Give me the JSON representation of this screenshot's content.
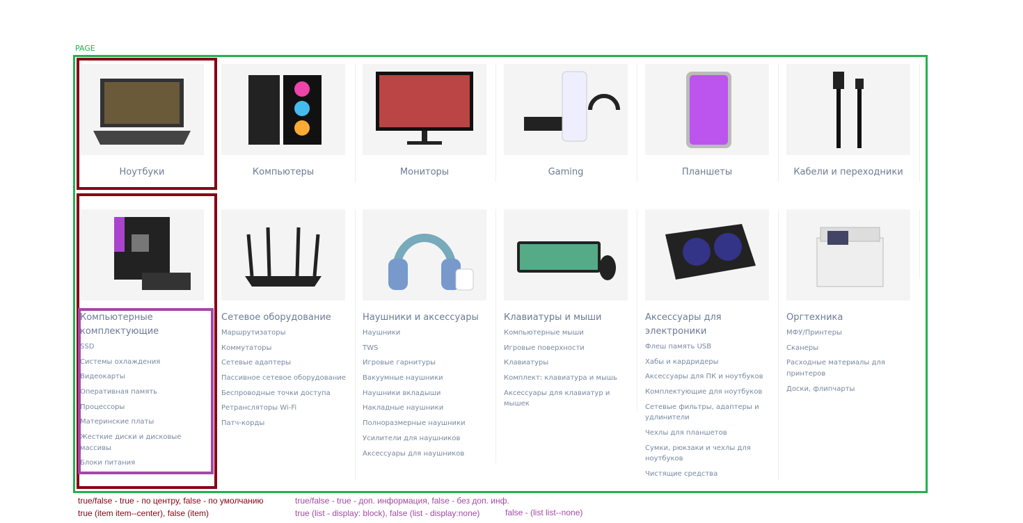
{
  "page_label": "PAGE",
  "row1": [
    {
      "label": "Ноутбуки",
      "icon": "laptop"
    },
    {
      "label": "Компьютеры",
      "icon": "pc-case"
    },
    {
      "label": "Мониторы",
      "icon": "monitor"
    },
    {
      "label": "Gaming",
      "icon": "console"
    },
    {
      "label": "Планшеты",
      "icon": "tablet"
    },
    {
      "label": "Кабели и переходники",
      "icon": "cable"
    }
  ],
  "row2": [
    {
      "title": "Компьютерные комплектующие",
      "icon": "motherboard",
      "items": [
        "SSD",
        "Системы охлаждения",
        "Видеокарты",
        "Оперативная память",
        "Процессоры",
        "Материнские платы",
        "Жесткие диски и дисковые массивы",
        "Блоки питания"
      ]
    },
    {
      "title": "Сетевое оборудование",
      "icon": "router",
      "items": [
        "Маршрутизаторы",
        "Коммутаторы",
        "Сетевые адаптеры",
        "Пассивное сетевое оборудование",
        "Беспроводные точки доступа",
        "Ретрансляторы Wi-Fi",
        "Патч-корды"
      ]
    },
    {
      "title": "Наушники и аксессуары",
      "icon": "headphones",
      "items": [
        "Наушники",
        "TWS",
        "Игровые гарнитуры",
        "Вакуумные наушники",
        "Наушники вкладыши",
        "Накладные наушники",
        "Полноразмерные наушники",
        "Усилители для наушников",
        "Аксессуары для наушников"
      ]
    },
    {
      "title": "Клавиатуры и мыши",
      "icon": "keyboard",
      "items": [
        "Компьютерные мыши",
        "Игровые поверхности",
        "Клавиатуры",
        "Комплект: клавиатура и мышь",
        "Аксессуары для клавиатур и мышек"
      ]
    },
    {
      "title": "Аксессуары для электроники",
      "icon": "cooling-pad",
      "items": [
        "Флеш память USB",
        "Хабы и кардридеры",
        "Аксессуары для ПК и ноутбуков",
        "Комплектующие для ноутбуков",
        "Сетевые фильтры, адаптеры и удлинители",
        "Чехлы для планшетов",
        "Сумки, рюкзаки и чехлы для ноутбуков",
        "Чистящие средства"
      ]
    },
    {
      "title": "Оргтехника",
      "icon": "printer",
      "items": [
        "МФУ/Принтеры",
        "Сканеры",
        "Расходные материалы для принтеров",
        "Доски, флипчарты"
      ]
    }
  ],
  "notes": {
    "center_1": "true/false - true - по центру, false - по умолчанию",
    "center_2": "true (item item--center), false (item)",
    "list_1": "true/false - true - доп. информация, false - без доп. инф.",
    "list_2": "true (list - display: block), false (list - display:none)",
    "list_3": "false - (list list--none)"
  },
  "colors": {
    "page": "#22b14c",
    "item": "#880015",
    "list": "#a349a4",
    "text": "#6b7b93"
  }
}
